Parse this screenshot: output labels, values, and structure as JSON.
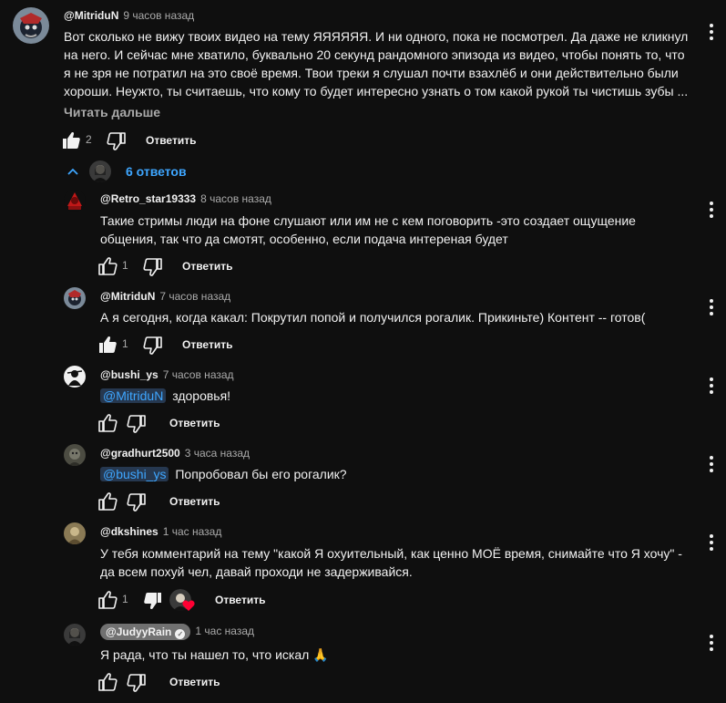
{
  "colors": {
    "background": "#0f0f0f",
    "text": "#f1f1f1",
    "muted": "#aaaaaa",
    "link": "#3ea6ff",
    "owner_badge": "#717171",
    "heart": "#ff0033"
  },
  "top_comment": {
    "author": "@MitriduN",
    "time": "9 часов назад",
    "text_lines": [
      "Вот сколько не вижу твоих видео на тему ЯЯЯЯЯЯ. И ни одного, пока не посмотрел. Да даже не кликнул",
      "на него. И сейчас мне хватило, буквально 20 секунд рандомного эпизода из видео, чтобы понять то, что",
      "я не зря не потратил на это своё время. Твои треки я слушал почти взахлёб и они действительно были",
      "хороши. Неужто, ты считаешь, что кому то будет интересно узнать о том какой рукой ты чистишь зубы ..."
    ],
    "read_more": "Читать дальше",
    "likes": "2",
    "reply_label": "Ответить"
  },
  "replies_toggle": {
    "label": "6 ответов",
    "icon": "chevron-up-icon"
  },
  "replies": [
    {
      "author": "@Retro_star19333",
      "time": "8 часов назад",
      "lines": [
        "Такие стримы люди на фоне слушают или им не с кем поговорить -это создает ощущение",
        "общения, так что да смотят, особенно, если подача интереная будет"
      ],
      "likes": "1",
      "reply_label": "Ответить"
    },
    {
      "author": "@MitriduN",
      "time": "7 часов назад",
      "lines": [
        "А я сегодня, когда какал: Покрутил попой и получился рогалик. Прикиньте) Контент -- готов("
      ],
      "likes": "1",
      "reply_label": "Ответить"
    },
    {
      "author": "@bushi_ys",
      "time": "7 часов назад",
      "mention": "@MitriduN",
      "text": "здоровья!",
      "reply_label": "Ответить"
    },
    {
      "author": "@gradhurt2500",
      "time": "3 часа назад",
      "mention": "@bushi_ys",
      "text": "Попробовал бы его рогалик?",
      "reply_label": "Ответить"
    },
    {
      "author": "@dkshines",
      "time": "1 час назад",
      "lines": [
        "У тебя комментарий на тему \"какой Я охуительный, как ценно МОЁ время, снимайте что Я хочу\" -",
        "да всем похуй чел, давай проходи не задерживайся."
      ],
      "likes": "1",
      "reply_label": "Ответить"
    },
    {
      "author": "@JudyyRain",
      "time": "1 час назад",
      "lines": [
        "Я рада, что ты нашел то, что искал 🙏"
      ],
      "reply_label": "Ответить"
    }
  ]
}
